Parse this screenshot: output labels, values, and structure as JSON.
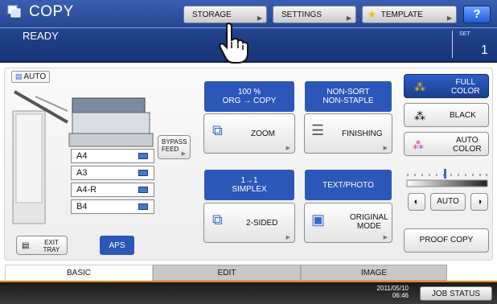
{
  "header": {
    "title": "COPY",
    "status": "READY",
    "set_label": "SET",
    "set_value": "1",
    "buttons": {
      "storage": "STORAGE",
      "settings": "SETTINGS",
      "template": "TEMPLATE",
      "help": "?"
    }
  },
  "machine": {
    "auto_label": "AUTO",
    "bypass_label": "BYPASS FEED",
    "exit_tray_label": "EXIT TRAY",
    "aps_label": "APS",
    "trays": [
      "A4",
      "A3",
      "A4-R",
      "B4"
    ]
  },
  "functions": {
    "zoom": {
      "status_line1": "100 %",
      "status_line2": "ORG → COPY",
      "label": "ZOOM"
    },
    "finishing": {
      "status_line1": "NON-SORT",
      "status_line2": "NON-STAPLE",
      "label": "FINISHING"
    },
    "duplex": {
      "status_line1": "1→1",
      "status_line2": "SIMPLEX",
      "label": "2-SIDED"
    },
    "original_mode": {
      "status_line1": "TEXT/PHOTO",
      "label_line1": "ORIGINAL",
      "label_line2": "MODE"
    }
  },
  "color": {
    "full_line1": "FULL",
    "full_line2": "COLOR",
    "black": "BLACK",
    "auto_line1": "AUTO",
    "auto_line2": "COLOR"
  },
  "density": {
    "auto_label": "AUTO"
  },
  "proof_copy": "PROOF COPY",
  "tabs": [
    "BASIC",
    "EDIT",
    "IMAGE"
  ],
  "footer": {
    "date": "2011/05/10",
    "time": "06:46",
    "job_status": "JOB STATUS"
  },
  "colors": {
    "header": "#1f3f86",
    "accent_orange": "#f08a1c",
    "status_blue": "#2b57b8"
  }
}
